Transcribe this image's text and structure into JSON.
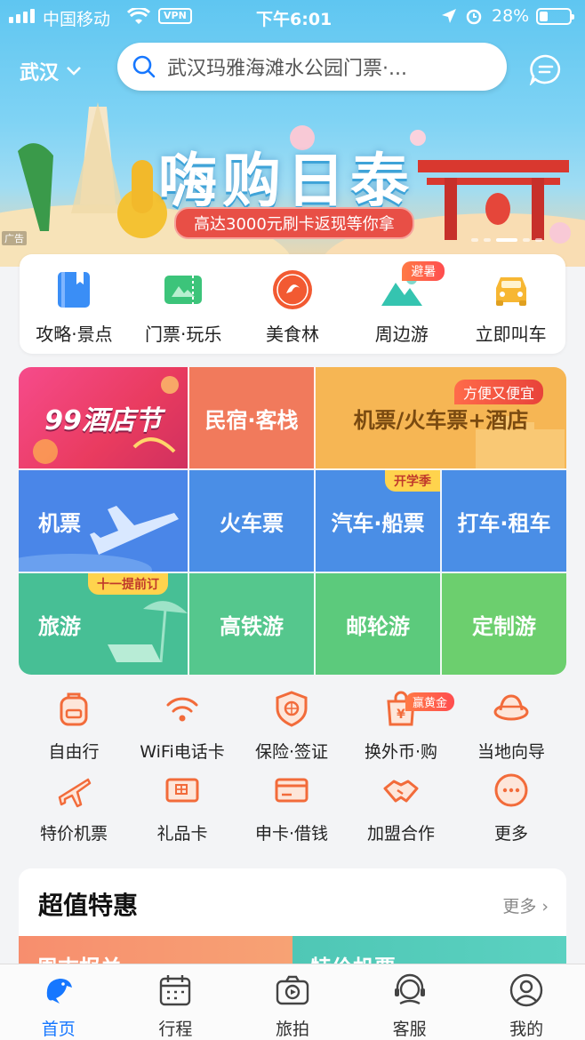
{
  "status_bar": {
    "carrier": "中国移动",
    "vpn": "VPN",
    "time": "下午6:01",
    "battery": "28%",
    "battery_level": 0.28
  },
  "header": {
    "city": "武汉",
    "search_placeholder": "武汉玛雅海滩水公园门票·..."
  },
  "banner": {
    "title": "嗨购日泰",
    "subtitle": "高达3000元刷卡返现等你拿",
    "ad_label": "广告"
  },
  "quick_menu": [
    {
      "label": "攻略·景点",
      "icon": "guide-book-icon"
    },
    {
      "label": "门票·玩乐",
      "icon": "ticket-icon"
    },
    {
      "label": "美食林",
      "icon": "food-forest-icon"
    },
    {
      "label": "周边游",
      "icon": "mountain-icon",
      "badge": "避暑"
    },
    {
      "label": "立即叫车",
      "icon": "car-icon"
    }
  ],
  "grid": {
    "hotel_fest": "99酒店节",
    "homestay": "民宿·客栈",
    "flight_train_hotel": "机票/火车票+酒店",
    "flight_train_hotel_badge": "方便又便宜",
    "flight": "机票",
    "train": "火车票",
    "bus_ship": "汽车·船票",
    "bus_ship_badge": "开学季",
    "taxi_rental": "打车·租车",
    "travel": "旅游",
    "travel_badge": "十一提前订",
    "highspeed": "高铁游",
    "cruise": "邮轮游",
    "custom": "定制游",
    "colors": {
      "red": "#f26b5b",
      "orange": "#f6b352",
      "blue": "#4a90e2",
      "green": "#5cc98d"
    }
  },
  "icon_menu": [
    {
      "label": "自由行",
      "icon": "backpack-icon"
    },
    {
      "label": "WiFi电话卡",
      "icon": "wifi-icon"
    },
    {
      "label": "保险·签证",
      "icon": "shield-icon"
    },
    {
      "label": "换外币·购",
      "icon": "currency-bag-icon",
      "badge": "赢黄金"
    },
    {
      "label": "当地向导",
      "icon": "guide-hat-icon"
    },
    {
      "label": "特价机票",
      "icon": "plane-icon"
    },
    {
      "label": "礼品卡",
      "icon": "gift-card-icon"
    },
    {
      "label": "申卡·借钱",
      "icon": "credit-card-icon"
    },
    {
      "label": "加盟合作",
      "icon": "handshake-icon"
    },
    {
      "label": "更多",
      "icon": "more-icon"
    }
  ],
  "deals": {
    "title": "超值特惠",
    "more": "更多",
    "card1": "周末报关",
    "card2": "特价机票"
  },
  "tabbar": [
    {
      "label": "首页",
      "icon": "dolphin-home-icon",
      "active": true
    },
    {
      "label": "行程",
      "icon": "calendar-icon"
    },
    {
      "label": "旅拍",
      "icon": "camera-icon"
    },
    {
      "label": "客服",
      "icon": "headset-icon"
    },
    {
      "label": "我的",
      "icon": "profile-icon"
    }
  ],
  "accent": "#1677ff",
  "icon_orange": "#f26b3a"
}
